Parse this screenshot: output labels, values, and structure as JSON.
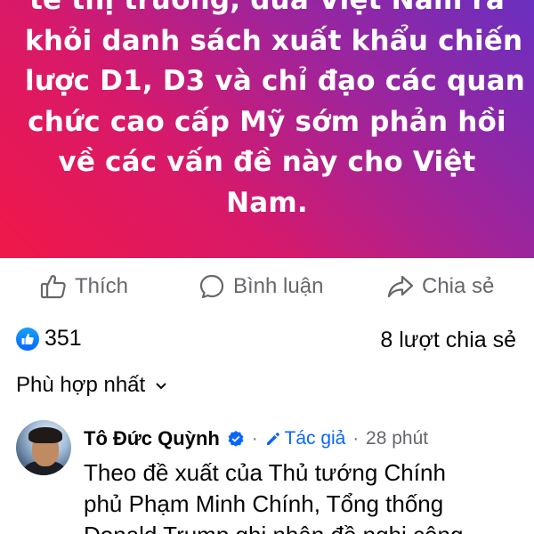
{
  "post": {
    "lines": [
      "tế thị trường, đưa Việt Nam ra",
      "khỏi danh sách xuất khẩu chiến",
      "lược D1, D3 và chỉ đạo các quan",
      "chức cao cấp Mỹ sớm phản hồi",
      "về các vấn đề này cho Việt",
      "Nam."
    ]
  },
  "actions": {
    "like": "Thích",
    "comment": "Bình luận",
    "share": "Chia sẻ"
  },
  "stats": {
    "likes": "351",
    "shares": "8 lượt chia sẻ"
  },
  "sort": {
    "label": "Phù hợp nhất"
  },
  "comment": {
    "name": "Tô Đức Quỳnh",
    "author_badge": "Tác giả",
    "separator": "·",
    "time": "28 phút",
    "lines": [
      "Theo đề xuất của Thủ tướng Chính",
      "phủ Phạm Minh Chính, Tổng thống",
      "Donald Trump ghi nhận đề nghị công"
    ]
  },
  "colors": {
    "gradient_start": "#f01848",
    "gradient_end": "#6a2fc0",
    "action_gray": "#65676b",
    "link_blue": "#0866ff"
  }
}
